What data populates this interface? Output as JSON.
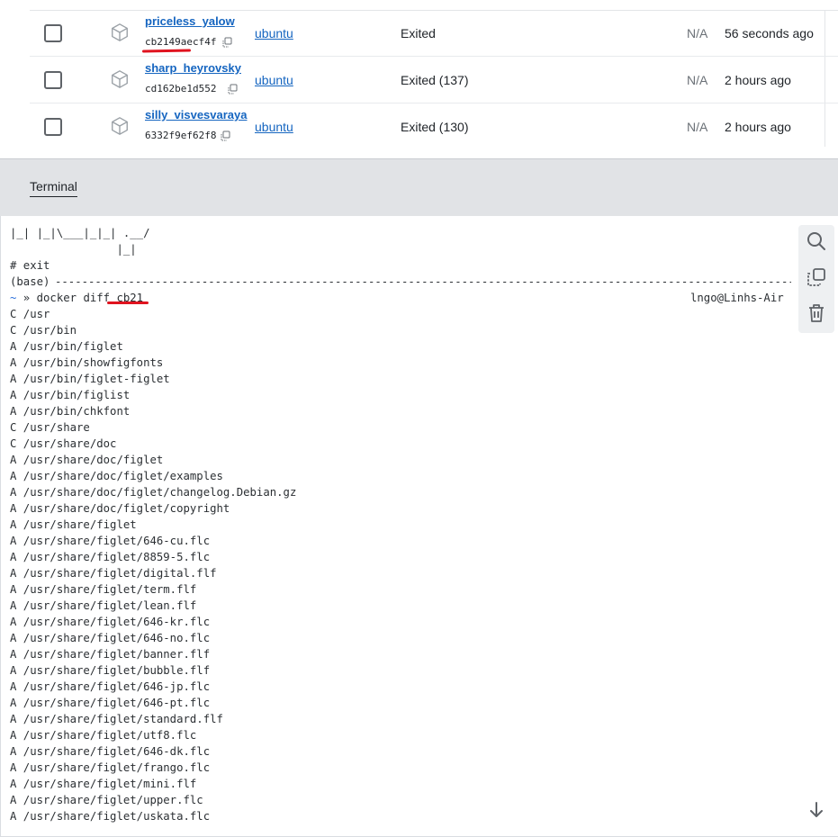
{
  "containers": [
    {
      "name": "priceless_yalow",
      "id": "cb2149aecf4f",
      "image": "ubuntu",
      "status": "Exited",
      "ports": "N/A",
      "created": "56 seconds ago"
    },
    {
      "name": "sharp_heyrovsky",
      "id": "cd162be1d552",
      "image": "ubuntu",
      "status": "Exited (137)",
      "ports": "N/A",
      "created": "2 hours ago"
    },
    {
      "name": "silly_visvesvaraya",
      "id": "6332f9ef62f8",
      "image": "ubuntu",
      "status": "Exited (130)",
      "ports": "N/A",
      "created": "2 hours ago"
    }
  ],
  "tabs": {
    "terminal": "Terminal"
  },
  "terminal": {
    "header_lines": "|_| |_|\\___|_|_| .__/\n                |_|\n# exit",
    "base_prefix": "(base) ",
    "dash_fill": "-----------------------------------------------------------------------------------------------------------------------------------",
    "prompt_symbol": "~",
    "prompt_rest": " » docker diff cb21",
    "hostname": "lngo@Linhs-Air",
    "output_lines": "C /usr\nC /usr/bin\nA /usr/bin/figlet\nA /usr/bin/showfigfonts\nA /usr/bin/figlet-figlet\nA /usr/bin/figlist\nA /usr/bin/chkfont\nC /usr/share\nC /usr/share/doc\nA /usr/share/doc/figlet\nA /usr/share/doc/figlet/examples\nA /usr/share/doc/figlet/changelog.Debian.gz\nA /usr/share/doc/figlet/copyright\nA /usr/share/figlet\nA /usr/share/figlet/646-cu.flc\nA /usr/share/figlet/8859-5.flc\nA /usr/share/figlet/digital.flf\nA /usr/share/figlet/term.flf\nA /usr/share/figlet/lean.flf\nA /usr/share/figlet/646-kr.flc\nA /usr/share/figlet/646-no.flc\nA /usr/share/figlet/banner.flf\nA /usr/share/figlet/bubble.flf\nA /usr/share/figlet/646-jp.flc\nA /usr/share/figlet/646-pt.flc\nA /usr/share/figlet/standard.flf\nA /usr/share/figlet/utf8.flc\nA /usr/share/figlet/646-dk.flc\nA /usr/share/figlet/frango.flc\nA /usr/share/figlet/mini.flf\nA /usr/share/figlet/upper.flc\nA /usr/share/figlet/uskata.flc"
  },
  "icons": {
    "row_icon": "container-cube-icon",
    "copy": "copy-icon",
    "search": "search-icon",
    "copy_all": "copy-icon",
    "clear": "trash-icon",
    "scroll": "arrow-down-icon"
  },
  "colors": {
    "link": "#1565c0",
    "annotation": "#e0131f",
    "tab_bar": "#e1e3e6"
  }
}
